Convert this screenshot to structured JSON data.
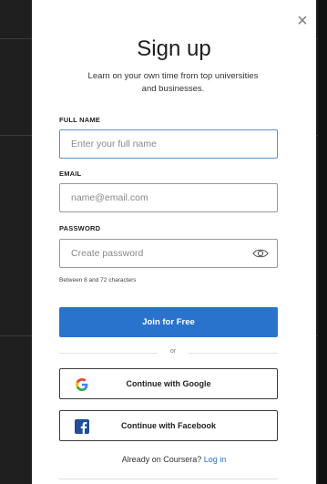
{
  "modal": {
    "close_glyph": "×",
    "title": "Sign up",
    "subtitle": "Learn on your own time from top universities and businesses."
  },
  "form": {
    "full_name": {
      "label": "FULL NAME",
      "placeholder": "Enter your full name",
      "value": ""
    },
    "email": {
      "label": "EMAIL",
      "placeholder": "name@email.com",
      "value": ""
    },
    "password": {
      "label": "PASSWORD",
      "placeholder": "Create password",
      "value": "",
      "hint": "Between 8 and 72 characters"
    },
    "submit_label": "Join for Free"
  },
  "divider_text": "or",
  "social": {
    "google_label": "Continue with Google",
    "facebook_label": "Continue with Facebook"
  },
  "footer": {
    "prompt": "Already on Coursera?",
    "login_label": "Log in"
  },
  "colors": {
    "primary": "#2a73cc",
    "facebook": "#1f4f9b",
    "google_blue": "#4285F4",
    "google_red": "#EA4335",
    "google_yellow": "#FBBC05",
    "google_green": "#34A853"
  },
  "icons": [
    "close-icon",
    "eye-icon",
    "google-icon",
    "facebook-icon"
  ]
}
